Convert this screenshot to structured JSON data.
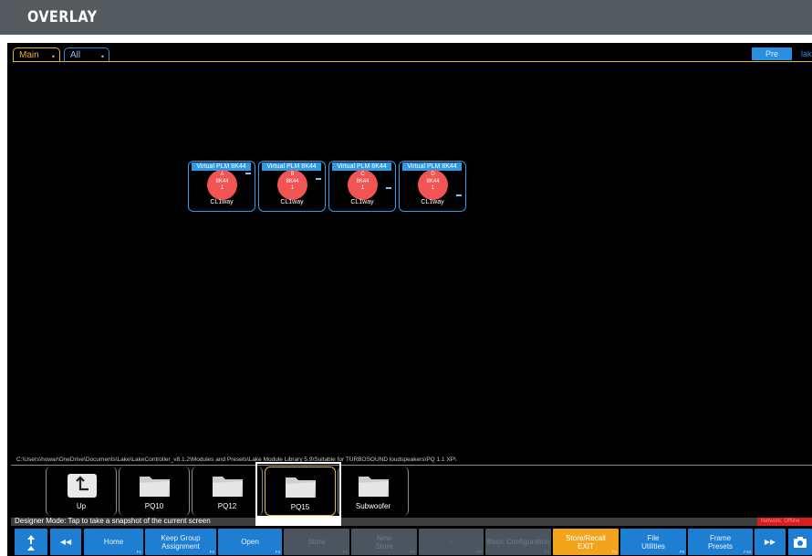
{
  "overlay": {
    "title": "OVERLAY"
  },
  "tabs": [
    {
      "label": "Main",
      "marker": "•"
    },
    {
      "label": "All",
      "marker": "•"
    }
  ],
  "top_right": {
    "pre_label": "Pre",
    "lake_label": "lak"
  },
  "devices": [
    {
      "title": "Virtual PLM 8K44",
      "letter": "A",
      "model": "8K44",
      "num": "1",
      "config": "CL1way"
    },
    {
      "title": "Virtual PLM 8K44",
      "letter": "B",
      "model": "8K44",
      "num": "1",
      "config": "CL1way"
    },
    {
      "title": "Virtual PLM 8K44",
      "letter": "C",
      "model": "8K44",
      "num": "1",
      "config": "CL1way"
    },
    {
      "title": "Virtual PLM 8K44",
      "letter": "D",
      "model": "8K44",
      "num": "1",
      "config": "CL1way"
    }
  ],
  "path": "C:\\Users\\howar\\OneDrive\\Documents\\Lake\\LakeController_v8.1.2\\Modules and Presets\\Lake Module Library 5.9\\Suitable for TURBOSOUND loudspeakers\\PQ 1.1 XP\\",
  "folders": [
    {
      "label": "Up",
      "icon": "up-arrow-icon"
    },
    {
      "label": "PQ10",
      "icon": "folder-icon"
    },
    {
      "label": "PQ12",
      "icon": "folder-icon"
    },
    {
      "label": "PQ15",
      "icon": "folder-icon",
      "selected": true
    },
    {
      "label": "Subwoofer",
      "icon": "folder-icon"
    }
  ],
  "status": {
    "text": "Designer Mode: Tap to take a snapshot of the current screen",
    "network": "Network: Offline"
  },
  "toolbar": {
    "buttons": [
      {
        "label": "↑",
        "fkey": "",
        "state": "enabled",
        "icon": "up-level-icon"
      },
      {
        "label": "◀◀",
        "fkey": "",
        "state": "enabled",
        "icon": "rewind-icon"
      },
      {
        "label": "Home",
        "fkey": "F1",
        "state": "enabled"
      },
      {
        "label": "Keep Group Assignment",
        "fkey": "F2",
        "state": "enabled"
      },
      {
        "label": "Open",
        "fkey": "F3",
        "state": "enabled"
      },
      {
        "label": "Store",
        "fkey": "F4",
        "state": "disabled"
      },
      {
        "label": "New Store",
        "fkey": "F5",
        "state": "disabled"
      },
      {
        "label": "-",
        "fkey": "F6",
        "state": "disabled"
      },
      {
        "label": "Basic Configuration",
        "fkey": "F7",
        "state": "disabled"
      },
      {
        "label": "Store/Recall EXIT",
        "fkey": "F8",
        "state": "active"
      },
      {
        "label": "File Utilities",
        "fkey": "F9",
        "state": "enabled"
      },
      {
        "label": "Frame Presets",
        "fkey": "F10",
        "state": "enabled"
      },
      {
        "label": "▶▶",
        "fkey": "",
        "state": "enabled",
        "icon": "fast-forward-icon"
      },
      {
        "label": "",
        "fkey": "",
        "state": "enabled",
        "icon": "camera-icon"
      }
    ]
  }
}
